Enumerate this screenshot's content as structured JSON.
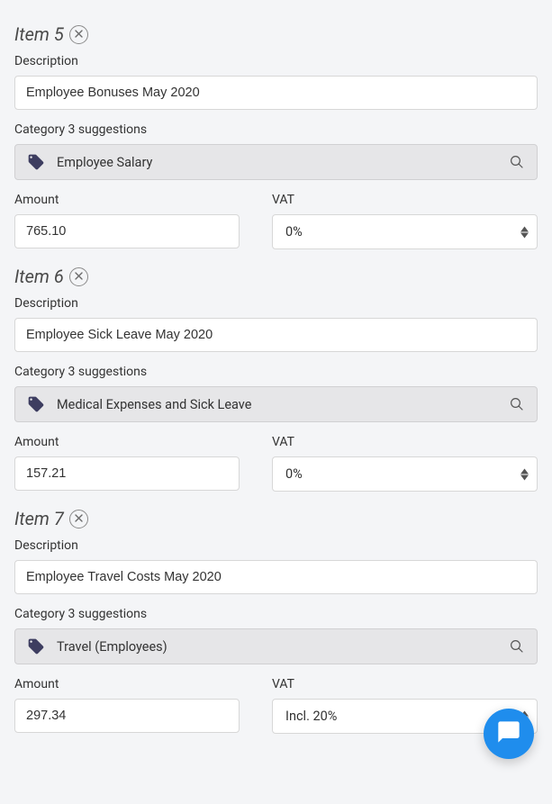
{
  "labels": {
    "description": "Description",
    "category_suggestions": "Category 3 suggestions",
    "amount": "Amount",
    "vat": "VAT"
  },
  "items": [
    {
      "title": "Item 5",
      "description": "Employee Bonuses May 2020",
      "category": "Employee Salary",
      "amount": "765.10",
      "vat": "0%"
    },
    {
      "title": "Item 6",
      "description": "Employee Sick Leave May 2020",
      "category": "Medical Expenses and Sick Leave",
      "amount": "157.21",
      "vat": "0%"
    },
    {
      "title": "Item 7",
      "description": "Employee Travel Costs May 2020",
      "category": "Travel (Employees)",
      "amount": "297.34",
      "vat": "Incl. 20%"
    }
  ]
}
